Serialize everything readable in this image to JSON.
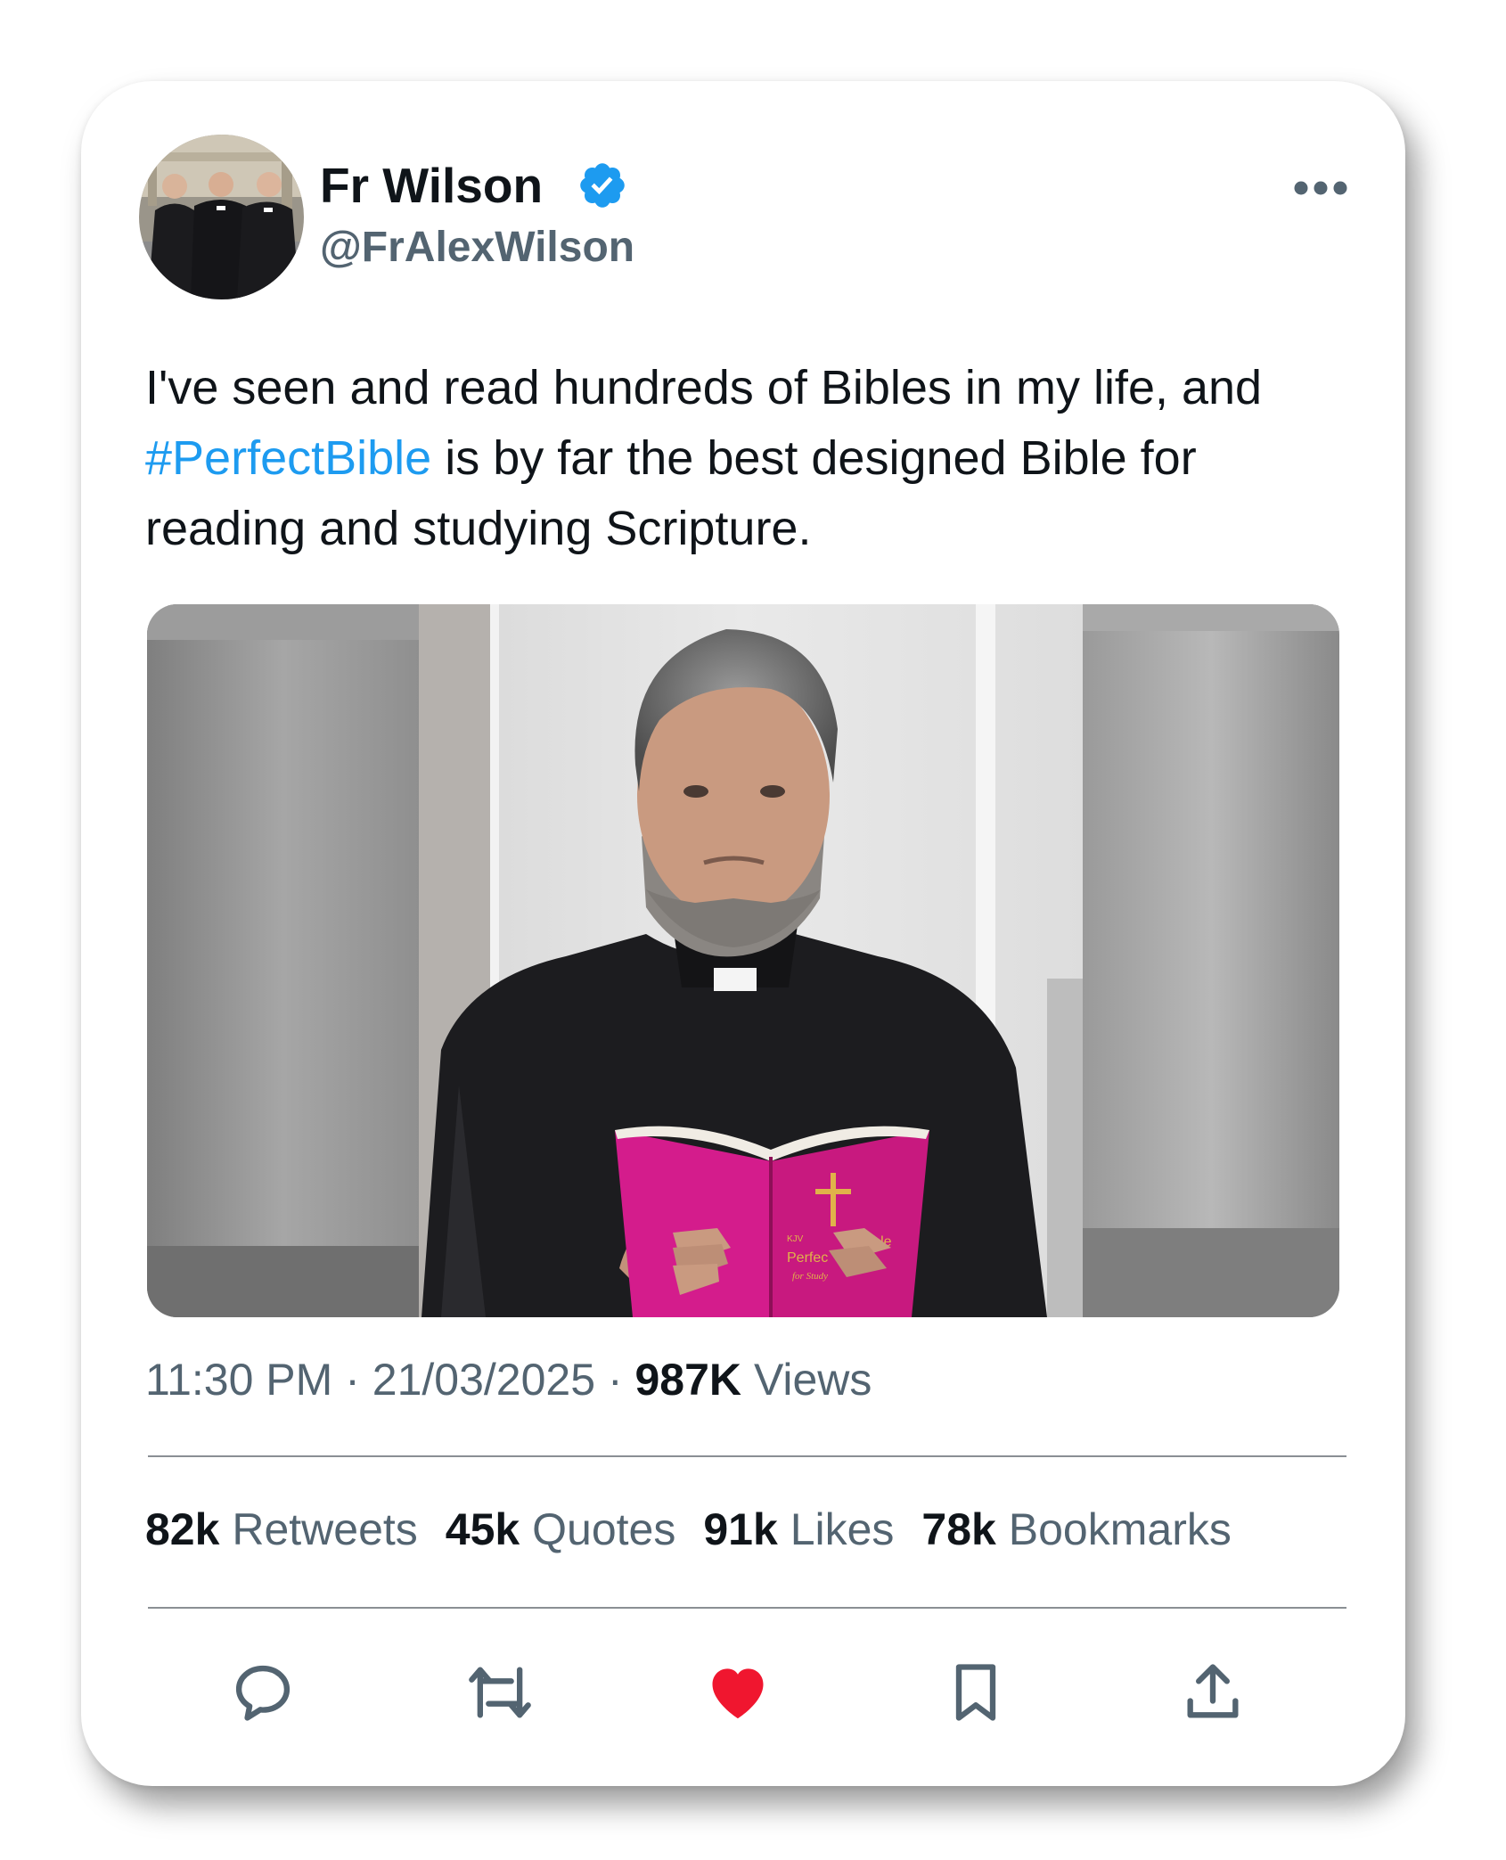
{
  "user": {
    "display_name": "Fr Wilson",
    "handle": "@FrAlexWilson",
    "verified": true
  },
  "tweet": {
    "text_before": "I've seen and read hundreds of Bibles in my life, and ",
    "hashtag": "#PerfectBible",
    "text_after": " is by far the best designed Bible for reading and studying Scripture."
  },
  "media": {
    "book_text": {
      "edition": "KJV",
      "title_part1": "Perfec",
      "title_part2": "Bible",
      "subtitle": "for Study"
    }
  },
  "meta": {
    "time": "11:30 PM",
    "separator": "·",
    "date": "21/03/2025",
    "views_count": "987K",
    "views_label": "Views"
  },
  "stats": [
    {
      "count": "82k",
      "label": "Retweets"
    },
    {
      "count": "45k",
      "label": "Quotes"
    },
    {
      "count": "91k",
      "label": "Likes"
    },
    {
      "count": "78k",
      "label": "Bookmarks"
    }
  ],
  "actions": {
    "reply_icon": "speech-bubble",
    "retweet_icon": "retweet-arrows",
    "like_icon": "heart-filled",
    "bookmark_icon": "bookmark-outline",
    "share_icon": "upload-arrow"
  },
  "colors": {
    "text": "#0f1419",
    "secondary": "#536471",
    "link": "#1d9bf0",
    "verified": "#1d9bf0",
    "like": "#f91880",
    "book": "#d41c8c"
  }
}
